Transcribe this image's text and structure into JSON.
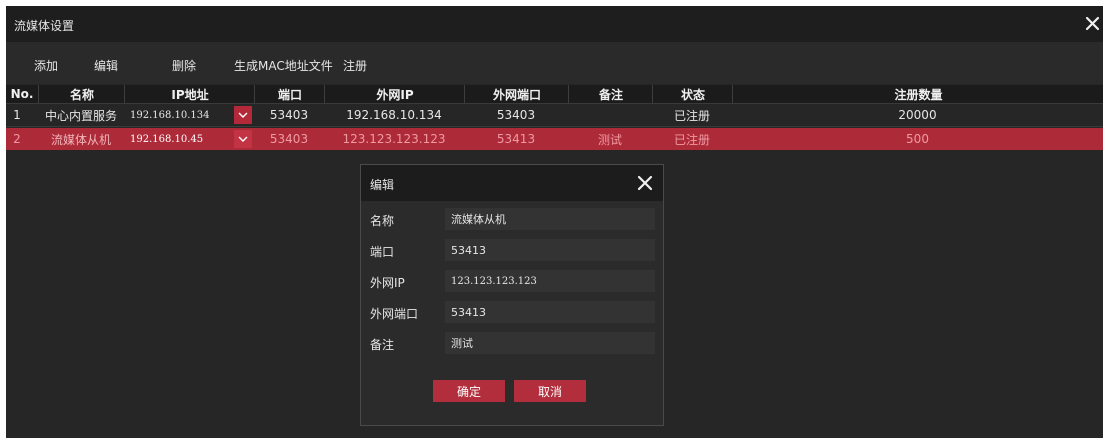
{
  "window": {
    "title": "流媒体设置"
  },
  "toolbar": {
    "add_label": "添加",
    "edit_label": "编辑",
    "delete_label": "删除",
    "gen_mac_label": "生成MAC地址文件",
    "register_label": "注册"
  },
  "table": {
    "headers": {
      "no": "No.",
      "name": "名称",
      "ip": "IP地址",
      "port": "端口",
      "ext_ip": "外网IP",
      "ext_port": "外网端口",
      "remark": "备注",
      "status": "状态",
      "reg_count": "注册数量"
    },
    "rows": [
      {
        "no": "1",
        "name": "中心内置服务",
        "ip": "192.168.10.134",
        "port": "53403",
        "ext_ip": "192.168.10.134",
        "ext_port": "53403",
        "remark": "",
        "status": "已注册",
        "reg_count": "20000"
      },
      {
        "no": "2",
        "name": "流媒体从机",
        "ip": "192.168.10.45",
        "port": "53403",
        "ext_ip": "123.123.123.123",
        "ext_port": "53413",
        "remark": "测试",
        "status": "已注册",
        "reg_count": "500"
      }
    ]
  },
  "dialog": {
    "title": "编辑",
    "name_label": "名称",
    "name_value": "流媒体从机",
    "port_label": "端口",
    "port_value": "53413",
    "ext_ip_label": "外网IP",
    "ext_ip_value": "123.123.123.123",
    "ext_port_label": "外网端口",
    "ext_port_value": "53413",
    "remark_label": "备注",
    "remark_value": "测试",
    "ok_label": "确定",
    "cancel_label": "取消"
  },
  "colors": {
    "accent_red": "#ad2a38",
    "background": "#262626",
    "titlebar": "#1e1e1e"
  },
  "icons": {
    "close": "close-icon",
    "dropdown": "chevron-down-icon"
  }
}
